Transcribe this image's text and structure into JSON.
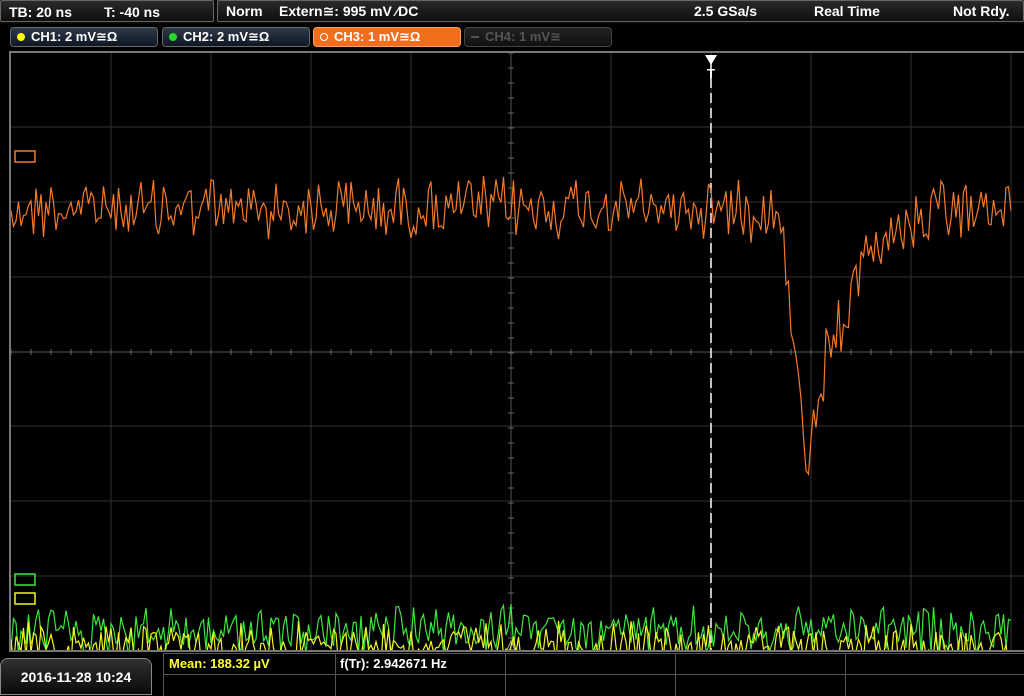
{
  "top_bar": {
    "timebase": "TB: 20 ns",
    "trigger_time": "T: -40 ns",
    "trigger_mode": "Norm",
    "trigger_source": "Extern≅: 995 mV ⁄DC",
    "sample_rate": "2.5 GSa/s",
    "acq_mode": "Real Time",
    "status": "Not Rdy."
  },
  "channels": [
    {
      "label": "CH1: 2 mV≅Ω",
      "color": "#ffff00",
      "state": "on"
    },
    {
      "label": "CH2: 2 mV≅Ω",
      "color": "#22dd22",
      "state": "on"
    },
    {
      "label": "CH3: 1 mV≅Ω",
      "color": "#f26d1c",
      "state": "active"
    },
    {
      "label": "CH4: 1 mV≅",
      "color": "#555555",
      "state": "off"
    }
  ],
  "screen": {
    "trigger_marker": "T",
    "traces": [
      {
        "name": "CH3",
        "color": "#f47a28",
        "kind": "noise_with_dip",
        "baseline": 155,
        "amplitude": 48,
        "dip_depth": 270
      },
      {
        "name": "CH2",
        "color": "#3ee63e",
        "kind": "noise",
        "baseline": 578,
        "amplitude": 38
      },
      {
        "name": "CH1",
        "color": "#f4f428",
        "kind": "noise",
        "baseline": 592,
        "amplitude": 34
      }
    ]
  },
  "bottom_bar": {
    "datetime": "2016-11-28 10:24",
    "measurements": [
      {
        "label": "Mean: 188.32 µV",
        "color": "#ffff33"
      },
      {
        "label": "f(Tr): 2.942671 Hz",
        "color": "#ffffff"
      }
    ]
  }
}
